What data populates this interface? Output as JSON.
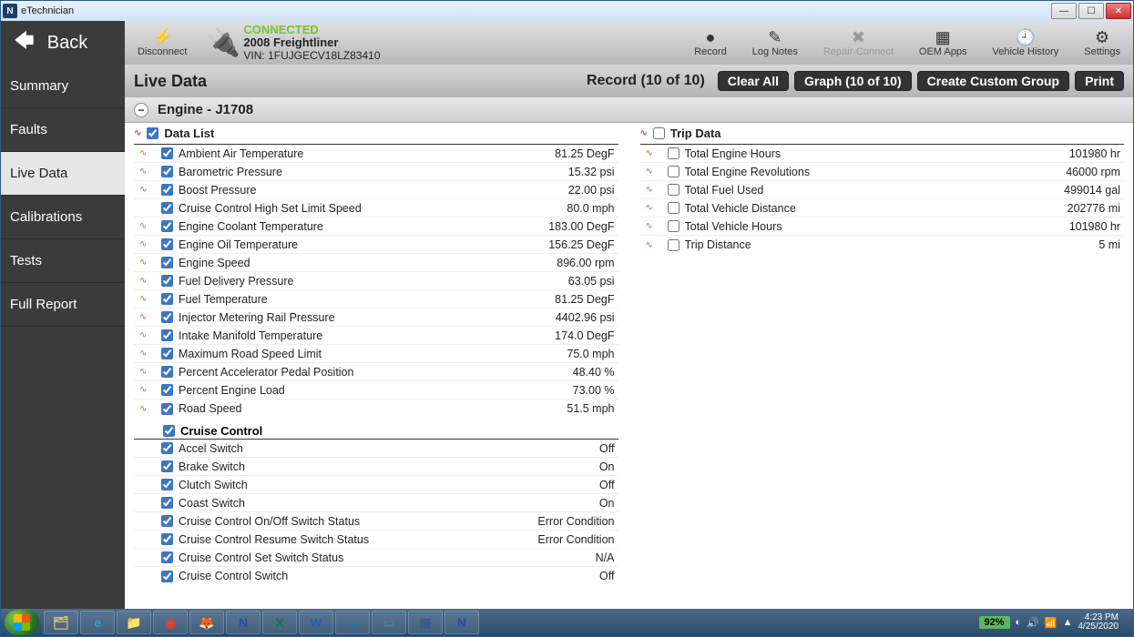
{
  "titlebar": {
    "app_name": "eTechnician",
    "icon_letter": "N"
  },
  "toolbar": {
    "back": "Back",
    "disconnect": "Disconnect",
    "conn_status": "CONNECTED",
    "vehicle": "2008 Freightliner",
    "vin": "VIN: 1FUJGECV18LZ83410",
    "right_items": [
      {
        "name": "record",
        "label": "Record",
        "glyph": "●"
      },
      {
        "name": "log-notes",
        "label": "Log Notes",
        "glyph": "✎"
      },
      {
        "name": "repair-connect",
        "label": "Repair-Connect",
        "glyph": "✖",
        "disabled": true
      },
      {
        "name": "oem-apps",
        "label": "OEM Apps",
        "glyph": "▦"
      },
      {
        "name": "vehicle-history",
        "label": "Vehicle History",
        "glyph": "🕘"
      },
      {
        "name": "settings",
        "label": "Settings",
        "glyph": "⚙"
      }
    ]
  },
  "sidebar": {
    "items": [
      {
        "name": "summary",
        "label": "Summary"
      },
      {
        "name": "faults",
        "label": "Faults"
      },
      {
        "name": "live-data",
        "label": "Live Data",
        "active": true
      },
      {
        "name": "calibrations",
        "label": "Calibrations"
      },
      {
        "name": "tests",
        "label": "Tests"
      },
      {
        "name": "full-report",
        "label": "Full Report"
      }
    ]
  },
  "page": {
    "title": "Live Data",
    "record_info": "Record (10 of 10)",
    "buttons": {
      "clear_all": "Clear All",
      "graph": "Graph (10 of 10)",
      "custom_group": "Create Custom Group",
      "print": "Print"
    },
    "group_title": "Engine - J1708"
  },
  "data_list": {
    "header": "Data List",
    "header_checked": true,
    "rows": [
      {
        "label": "Ambient Air Temperature",
        "value": "81.25 DegF",
        "checked": true,
        "graph": true
      },
      {
        "label": "Barometric Pressure",
        "value": "15.32 psi",
        "checked": true,
        "graph": true
      },
      {
        "label": "Boost Pressure",
        "value": "22.00 psi",
        "checked": true,
        "graph": true
      },
      {
        "label": "Cruise Control High Set Limit Speed",
        "value": "80.0 mph",
        "checked": true,
        "graph": false
      },
      {
        "label": "Engine Coolant Temperature",
        "value": "183.00 DegF",
        "checked": true,
        "graph": true
      },
      {
        "label": "Engine Oil Temperature",
        "value": "156.25 DegF",
        "checked": true,
        "graph": true
      },
      {
        "label": "Engine Speed",
        "value": "896.00 rpm",
        "checked": true,
        "graph": true
      },
      {
        "label": "Fuel Delivery Pressure",
        "value": "63.05 psi",
        "checked": true,
        "graph": true
      },
      {
        "label": "Fuel Temperature",
        "value": "81.25 DegF",
        "checked": true,
        "graph": true
      },
      {
        "label": "Injector Metering Rail Pressure",
        "value": "4402.96 psi",
        "checked": true,
        "graph": true
      },
      {
        "label": "Intake Manifold Temperature",
        "value": "174.0 DegF",
        "checked": true,
        "graph": true
      },
      {
        "label": "Maximum Road Speed Limit",
        "value": "75.0 mph",
        "checked": true,
        "graph": true
      },
      {
        "label": "Percent Accelerator Pedal Position",
        "value": "48.40 %",
        "checked": true,
        "graph": true
      },
      {
        "label": "Percent Engine Load",
        "value": "73.00 %",
        "checked": true,
        "graph": true
      },
      {
        "label": "Road Speed",
        "value": "51.5 mph",
        "checked": true,
        "graph": true
      }
    ]
  },
  "cruise_control": {
    "header": "Cruise Control",
    "header_checked": true,
    "rows": [
      {
        "label": "Accel Switch",
        "value": "Off",
        "checked": true
      },
      {
        "label": "Brake Switch",
        "value": "On",
        "checked": true
      },
      {
        "label": "Clutch Switch",
        "value": "Off",
        "checked": true
      },
      {
        "label": "Coast Switch",
        "value": "On",
        "checked": true
      },
      {
        "label": "Cruise Control On/Off Switch Status",
        "value": "Error Condition",
        "checked": true
      },
      {
        "label": "Cruise Control Resume Switch Status",
        "value": "Error Condition",
        "checked": true
      },
      {
        "label": "Cruise Control Set Switch Status",
        "value": "N/A",
        "checked": true
      },
      {
        "label": "Cruise Control Switch",
        "value": "Off",
        "checked": true
      }
    ]
  },
  "trip_data": {
    "header": "Trip Data",
    "header_checked": false,
    "rows": [
      {
        "label": "Total Engine Hours",
        "value": "101980 hr",
        "checked": false,
        "graph": true
      },
      {
        "label": "Total Engine Revolutions",
        "value": "46000 rpm",
        "checked": false,
        "graph": true
      },
      {
        "label": "Total Fuel Used",
        "value": "499014 gal",
        "checked": false,
        "graph": true
      },
      {
        "label": "Total Vehicle Distance",
        "value": "202776 mi",
        "checked": false,
        "graph": true
      },
      {
        "label": "Total Vehicle Hours",
        "value": "101980 hr",
        "checked": false,
        "graph": true
      },
      {
        "label": "Trip Distance",
        "value": "5 mi",
        "checked": false,
        "graph": true
      }
    ]
  },
  "taskbar": {
    "apps": [
      {
        "name": "explorer",
        "glyph": "🗂",
        "color": "#f0c060"
      },
      {
        "name": "ie",
        "glyph": "e",
        "color": "#3a9bdc"
      },
      {
        "name": "files",
        "glyph": "📁",
        "color": "#f0c060"
      },
      {
        "name": "chrome",
        "glyph": "◉",
        "color": "#e04030"
      },
      {
        "name": "firefox",
        "glyph": "🦊",
        "color": "#ff7b00"
      },
      {
        "name": "nexiq1",
        "glyph": "N",
        "color": "#2a4aaa"
      },
      {
        "name": "excel",
        "glyph": "X",
        "color": "#1d6f42"
      },
      {
        "name": "word",
        "glyph": "W",
        "color": "#2a5aaa"
      },
      {
        "name": "teamviewer",
        "glyph": "↔",
        "color": "#0d7bd6"
      },
      {
        "name": "app1",
        "glyph": "▭",
        "color": "#5a7a9a"
      },
      {
        "name": "app2",
        "glyph": "▦",
        "color": "#3a5a8a"
      },
      {
        "name": "nexiq2",
        "glyph": "N",
        "color": "#2a4aaa"
      }
    ],
    "battery": "92%",
    "time": "4:23 PM",
    "date": "4/25/2020"
  }
}
